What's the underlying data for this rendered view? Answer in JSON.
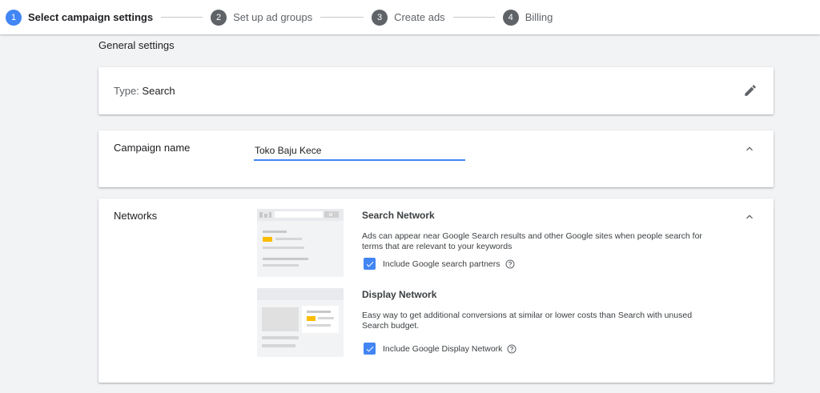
{
  "stepper": {
    "steps": [
      {
        "number": "1",
        "label": "Select campaign settings"
      },
      {
        "number": "2",
        "label": "Set up ad groups"
      },
      {
        "number": "3",
        "label": "Create ads"
      },
      {
        "number": "4",
        "label": "Billing"
      }
    ]
  },
  "section_title": "General settings",
  "type_card": {
    "label": "Type:",
    "value": "Search"
  },
  "campaign_name_card": {
    "label": "Campaign name",
    "value": "Toko Baju Kece"
  },
  "networks_card": {
    "label": "Networks",
    "search": {
      "title": "Search Network",
      "description": "Ads can appear near Google Search results and other Google sites when people search for terms that are relevant to your keywords",
      "checkbox_label": "Include Google search partners",
      "checked": true
    },
    "display": {
      "title": "Display Network",
      "description": "Easy way to get additional conversions at similar or lower costs than Search with unused Search budget.",
      "checkbox_label": "Include Google Display Network",
      "checked": true
    }
  },
  "colors": {
    "accent": "#4285f4",
    "highlight": "#fbbc04"
  },
  "icons": [
    "pencil-icon",
    "chevron-up-icon",
    "checkbox-checked-icon",
    "help-circle-icon"
  ]
}
